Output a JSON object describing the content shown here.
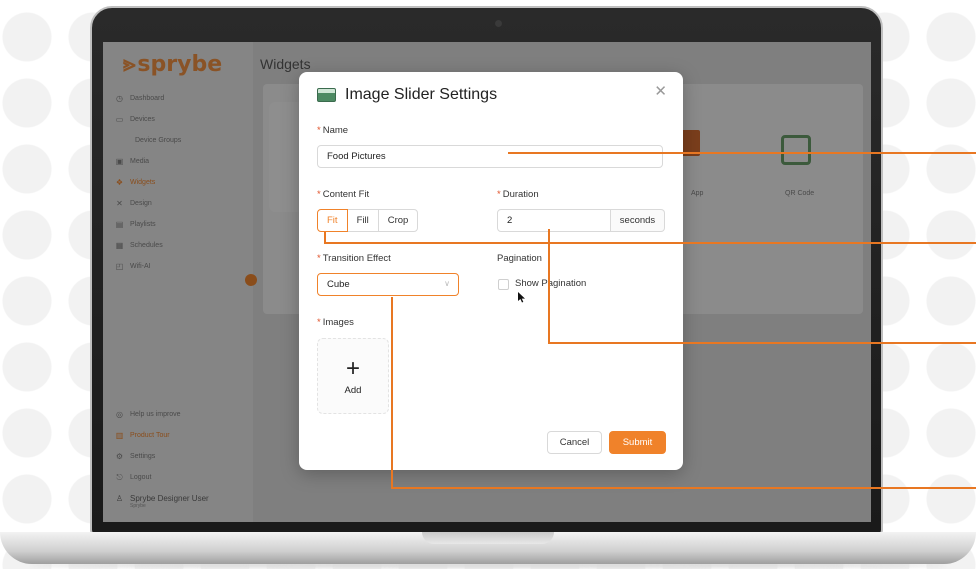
{
  "brand": {
    "name": "sprybe"
  },
  "app": {
    "title": "Widgets",
    "sidebar": {
      "items": [
        {
          "label": "Dashboard",
          "icon": "clock-icon"
        },
        {
          "label": "Devices",
          "icon": "devices-icon"
        },
        {
          "label": "Device Groups",
          "icon": ""
        },
        {
          "label": "Media",
          "icon": "media-icon"
        },
        {
          "label": "Widgets",
          "icon": "widgets-icon"
        },
        {
          "label": "Design",
          "icon": "design-icon"
        },
        {
          "label": "Playlists",
          "icon": "playlist-icon"
        },
        {
          "label": "Schedules",
          "icon": "calendar-icon"
        },
        {
          "label": "Wifi-AI",
          "icon": "wifi-icon"
        }
      ],
      "bottom_items": [
        {
          "label": "Help us improve",
          "icon": "help-icon"
        },
        {
          "label": "Product Tour",
          "icon": "tour-icon"
        },
        {
          "label": "Settings",
          "icon": "gear-icon"
        },
        {
          "label": "Logout",
          "icon": "logout-icon"
        }
      ],
      "user": {
        "name": "Sprybe Designer User",
        "sub": "Sprybe"
      }
    },
    "widgets": [
      {
        "label": "App"
      },
      {
        "label": "QR Code"
      }
    ]
  },
  "modal": {
    "title": "Image Slider Settings",
    "close_icon": "close-icon",
    "name": {
      "label": "Name",
      "value": "Food Pictures"
    },
    "content_fit": {
      "label": "Content Fit",
      "options": [
        "Fit",
        "Fill",
        "Crop"
      ],
      "selected": "Fit"
    },
    "duration": {
      "label": "Duration",
      "value": "2",
      "unit": "seconds"
    },
    "transition": {
      "label": "Transition Effect",
      "value": "Cube"
    },
    "pagination": {
      "label": "Pagination",
      "checkbox_label": "Show Pagination",
      "checked": false
    },
    "images": {
      "label": "Images",
      "upload_label": "Add"
    },
    "buttons": {
      "cancel": "Cancel",
      "submit": "Submit"
    },
    "required_mark": "*"
  },
  "colors": {
    "accent": "#f0822a",
    "callout": "#e87722"
  }
}
